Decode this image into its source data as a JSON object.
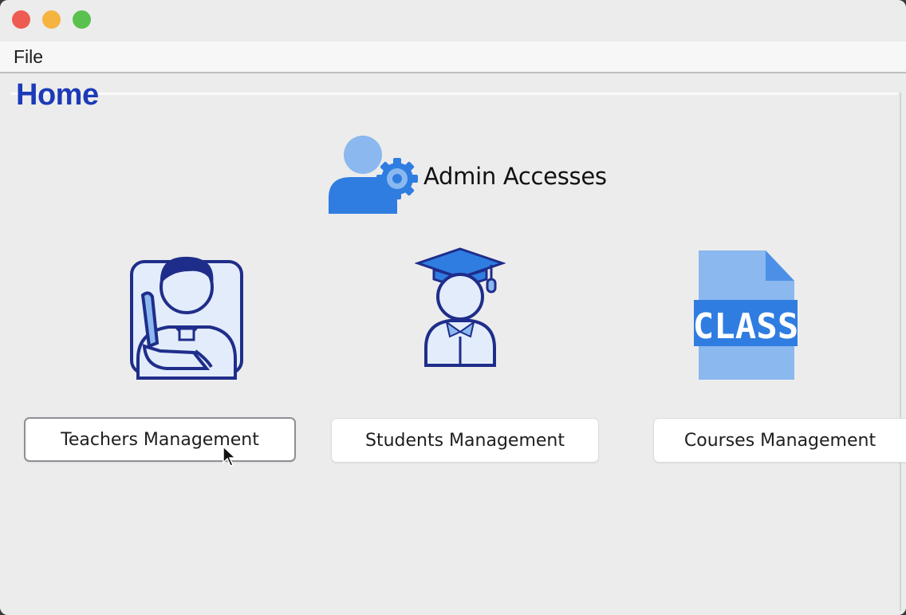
{
  "window": {
    "controls": [
      "close",
      "minimize",
      "zoom"
    ]
  },
  "menu": {
    "items": [
      {
        "label": "File"
      }
    ]
  },
  "page": {
    "title": "Home"
  },
  "admin": {
    "label": "Admin Accesses",
    "icon": "admin-gear-icon"
  },
  "cards": [
    {
      "icon": "teacher-icon",
      "button_label": "Teachers Management"
    },
    {
      "icon": "student-graduate-icon",
      "button_label": "Students Management"
    },
    {
      "icon": "class-file-icon",
      "icon_text": "CLASS",
      "button_label": "Courses Management"
    }
  ],
  "colors": {
    "title": "#1c3bb8",
    "icon_outline": "#1f2d8a",
    "icon_fill_light": "#e3ecfb",
    "accent_blue": "#2f7de1",
    "light_blue": "#9cc4f3"
  }
}
